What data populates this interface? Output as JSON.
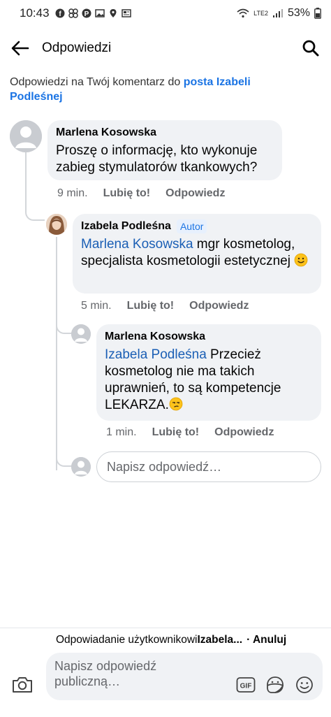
{
  "status_bar": {
    "time": "10:43",
    "network": "LTE2",
    "battery": "53%"
  },
  "header": {
    "title": "Odpowiedzi"
  },
  "notice": {
    "prefix": "Odpowiedzi na Twój komentarz do ",
    "link": "posta Izabeli Podleśnej"
  },
  "comments": [
    {
      "author": "Marlena Kosowska",
      "text": "Proszę o informację, kto wykonuje zabieg stymulatorów tkankowych?",
      "time": "9 min.",
      "like": "Lubię to!",
      "reply": "Odpowiedz"
    },
    {
      "author": "Izabela Podleśna",
      "badge": "Autor",
      "mention": "Marlena Kosowska",
      "text": " mgr kosmetolog, specjalista kosmetologii estetycznej ",
      "emoji": "slightly-smiling-face",
      "time": "5 min.",
      "like": "Lubię to!",
      "reply": "Odpowiedz"
    },
    {
      "author": "Marlena Kosowska",
      "mention": "Izabela Podleśna",
      "text": " Przecież kosmetolog nie ma takich uprawnień, to są kompetencje LEKARZA.",
      "emoji": "unamused-face",
      "time": "1 min.",
      "like": "Lubię to!",
      "reply": "Odpowiedz"
    }
  ],
  "reply_input": {
    "placeholder": "Napisz odpowiedź…"
  },
  "composer": {
    "replying_prefix": "Odpowiadanie użytkownikowi ",
    "replying_name": "Izabela...",
    "cancel": "· Anuluj",
    "placeholder": "Napisz odpowiedź publiczną…",
    "gif_label": "GIF"
  },
  "colors": {
    "link": "#1b74e4",
    "bubble": "#f0f2f5",
    "meta": "#65676b"
  }
}
